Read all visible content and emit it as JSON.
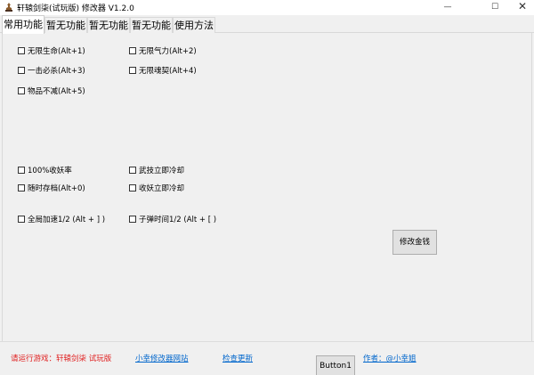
{
  "window": {
    "title": "轩辕剑柒(试玩版) 修改器  V1.2.0",
    "minimize_glyph": "—",
    "maximize_glyph": "☐",
    "close_glyph": "✕",
    "icon": "app-icon"
  },
  "tabs": [
    {
      "label": "常用功能",
      "active": true
    },
    {
      "label": "暂无功能",
      "active": false
    },
    {
      "label": "暂无功能",
      "active": false
    },
    {
      "label": "暂无功能",
      "active": false
    },
    {
      "label": "使用方法",
      "active": false
    }
  ],
  "checkboxes": {
    "infinite_hp": {
      "label": "无限生命(Alt+1)",
      "checked": false
    },
    "infinite_qi": {
      "label": "无限气力(Alt+2)",
      "checked": false
    },
    "one_hit_kill": {
      "label": "一击必杀(Alt+3)",
      "checked": false
    },
    "infinite_souls": {
      "label": "无限魂契(Alt+4)",
      "checked": false
    },
    "items_not_decrease": {
      "label": "物品不减(Alt+5)",
      "checked": false
    },
    "capture_rate": {
      "label": "100%收妖率",
      "checked": false
    },
    "skill_cooldown": {
      "label": "武技立即冷却",
      "checked": false
    },
    "save_anytime": {
      "label": "随时存档(Alt+0)",
      "checked": false
    },
    "capture_cooldown": {
      "label": "收妖立即冷却",
      "checked": false
    },
    "global_speed": {
      "label": "全局加速1/2 (Alt + ] )",
      "checked": false
    },
    "bullet_time": {
      "label": "子弹时间1/2 (Alt + [ )",
      "checked": false
    }
  },
  "buttons": {
    "modify_money": "修改金钱",
    "button1": "Button1"
  },
  "statusbar": {
    "run_game": "请运行游戏：轩辕剑柒 试玩版",
    "site_link": "小幸修改器网站",
    "update_link": "检查更新",
    "author_link": "作者：@小幸姐"
  },
  "colors": {
    "status_red": "#e02020",
    "link_blue": "#0066cc",
    "panel_bg": "#f0f0f0"
  }
}
